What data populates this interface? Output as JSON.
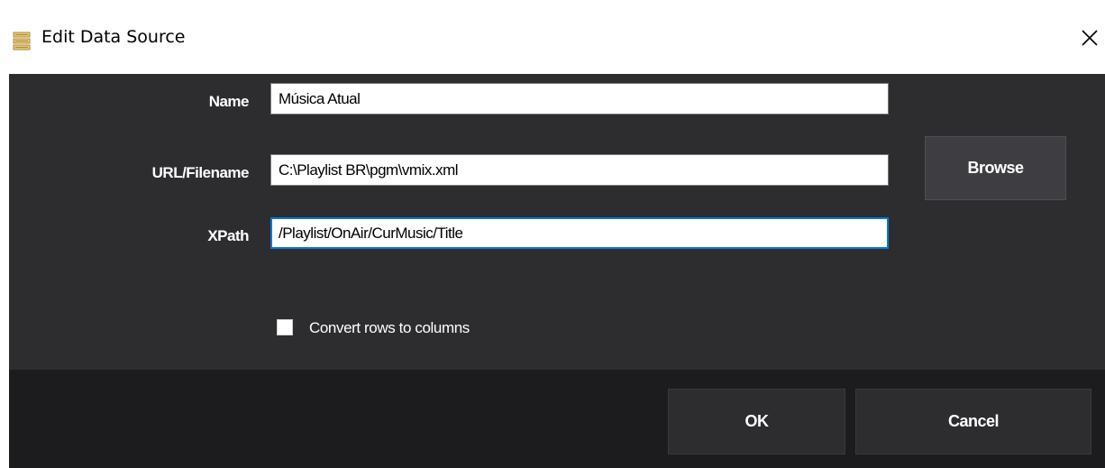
{
  "window": {
    "title": "Edit Data Source",
    "title_icon": "database-icon",
    "close_icon": "close-icon"
  },
  "form": {
    "name": {
      "label": "Name",
      "value": "Música Atual"
    },
    "url": {
      "label": "URL/Filename",
      "value": "C:\\Playlist BR\\pgm\\vmix.xml"
    },
    "xpath": {
      "label": "XPath",
      "value": "/Playlist/OnAir/CurMusic/Title"
    },
    "browse_label": "Browse",
    "convert_rows": {
      "label": "Convert rows to columns",
      "checked": false
    }
  },
  "footer": {
    "ok_label": "OK",
    "cancel_label": "Cancel"
  },
  "colors": {
    "body_bg": "#2d2d30",
    "footer_bg": "#1c1c1e",
    "focus_border": "#0a78d7"
  }
}
